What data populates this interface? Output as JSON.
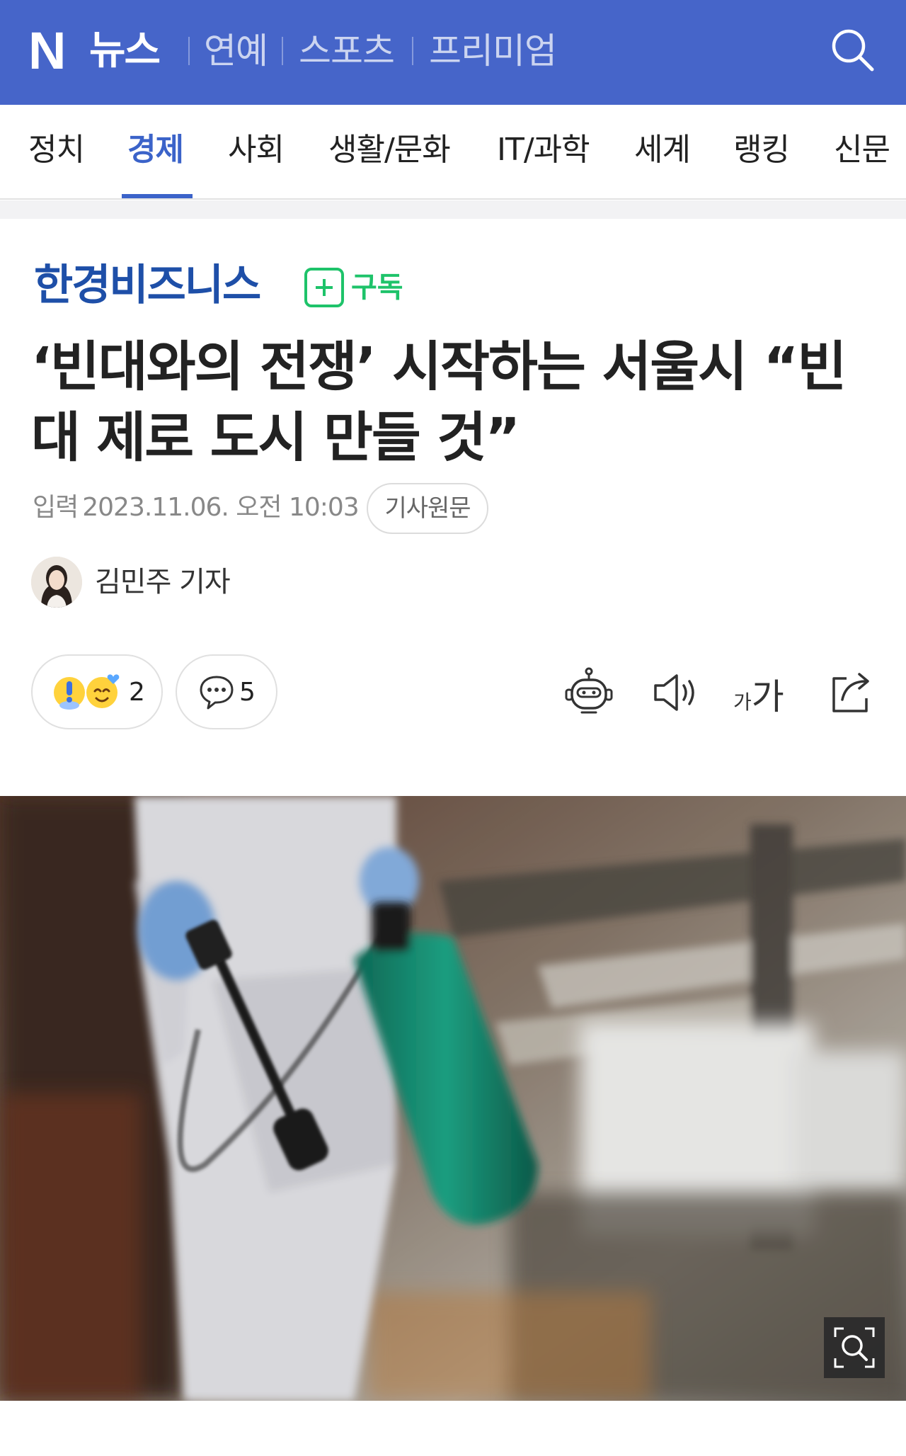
{
  "header": {
    "logo_letter": "N",
    "logo_text": "뉴스",
    "links": [
      "연예",
      "스포츠",
      "프리미엄"
    ],
    "search_icon": "search-icon"
  },
  "categories": {
    "items": [
      "정치",
      "경제",
      "사회",
      "생활/문화",
      "IT/과학",
      "세계",
      "랭킹",
      "신문"
    ],
    "active": "경제"
  },
  "press": {
    "name": "한경비즈니스",
    "subscribe_label": "구독",
    "subscribe_icon": "plus-box-icon"
  },
  "article": {
    "headline": "‘빈대와의 전쟁’ 시작하는 서울시 “빈대 제로 도시 만들 것”",
    "published_label": "입력",
    "published_datetime": "2023.11.06. 오전 10:03",
    "original_link_label": "기사원문",
    "reporter": "김민주 기자"
  },
  "reactions": {
    "reaction_count": "2",
    "comment_count": "5",
    "reaction_icons": [
      "surprise-emoji-icon",
      "heart-emoji-icon"
    ],
    "comment_icon": "speech-bubble-icon"
  },
  "tools": {
    "icons": [
      "summary-bot-icon",
      "speaker-icon",
      "font-size-icon",
      "share-icon"
    ],
    "font_size_small": "가",
    "font_size_big": "가"
  },
  "photo": {
    "zoom_icon": "zoom-magnifier-icon"
  },
  "colors": {
    "header_bg": "#4665c9",
    "active_category": "#3b63c9",
    "press_logo": "#1e4fa8",
    "subscribe": "#1ec36a"
  }
}
